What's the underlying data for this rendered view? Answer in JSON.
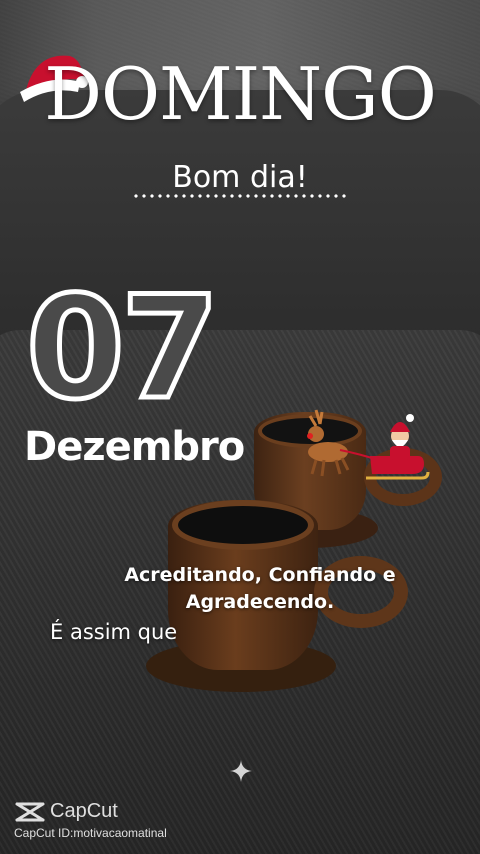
{
  "title": "DOMINGO",
  "greeting": "Bom dia!",
  "date": {
    "day": "07",
    "month": "Dezembro"
  },
  "message": {
    "line1": "Acreditando, Confiando e",
    "line2": "Agradecendo.",
    "continuation": "É assim que"
  },
  "watermark": {
    "brand": "CapCut",
    "id_text": "CapCut ID:motivacaomatinal"
  },
  "icons": {
    "hat": "santa-hat-icon",
    "sleigh": "santa-sleigh-icon",
    "sparkle": "sparkle-icon",
    "logo": "capcut-logo-icon"
  },
  "colors": {
    "hat_red": "#c8102e",
    "coffee_cup": "#6b3f20"
  }
}
